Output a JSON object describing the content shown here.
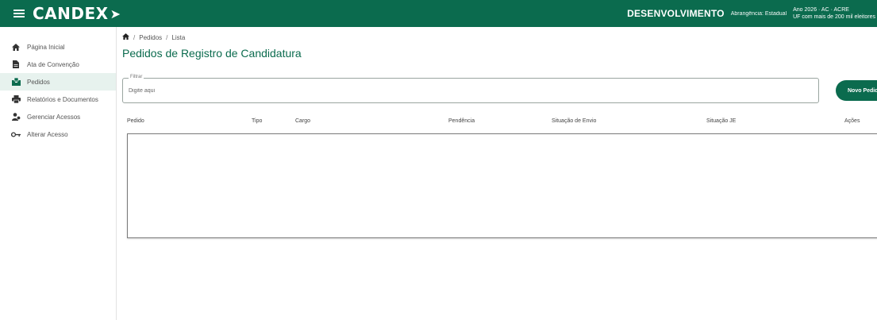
{
  "app": {
    "logo_text": "CANDEX",
    "environment_label": "DESENVOLVIMENTO",
    "scope_text": "Abrangência: Estadual",
    "election_line1": "Ano 2026 · AC · ACRE",
    "election_line2": "UF com mais de 200 mil eleitores",
    "brand_color": "#0b6b4e"
  },
  "sidebar": {
    "items": [
      {
        "label": "Página Inicial",
        "icon": "home-icon"
      },
      {
        "label": "Ata de Convenção",
        "icon": "document-icon"
      },
      {
        "label": "Pedidos",
        "icon": "ballot-box-icon"
      },
      {
        "label": "Relatórios e Documentos",
        "icon": "printer-icon"
      },
      {
        "label": "Gerenciar Acessos",
        "icon": "manage-access-icon"
      },
      {
        "label": "Alterar Acesso",
        "icon": "key-icon"
      }
    ],
    "active_item": "Pedidos"
  },
  "breadcrumb": {
    "items": [
      "Pedidos",
      "Lista"
    ]
  },
  "page": {
    "title": "Pedidos de Registro de Candidatura"
  },
  "search": {
    "legend": "Filtrar",
    "placeholder": "Digite aqui",
    "value": ""
  },
  "actions": {
    "new_button_label": "Novo Pedido"
  },
  "table": {
    "columns": [
      "Pedido",
      "Tipo",
      "Cargo",
      "Pendência",
      "Situação de Envio",
      "Situação JE",
      "Ações"
    ],
    "rows": []
  }
}
